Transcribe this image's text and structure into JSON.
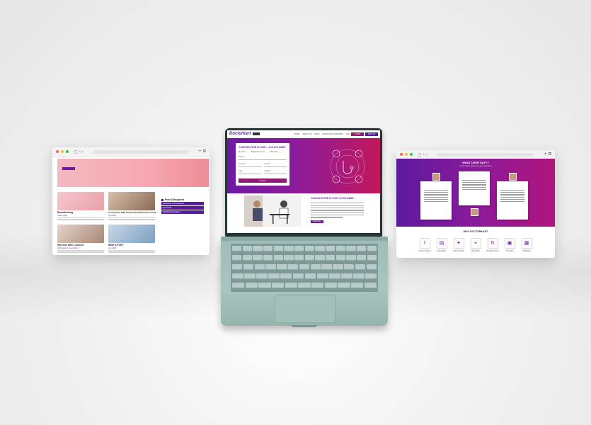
{
  "left_window": {
    "sidebar_title": "Post Categories",
    "categories": [
      "Wellness & Cosmetics",
      "Covid-19",
      "Medical Education"
    ],
    "cards": [
      {
        "title": "Breastfeeding",
        "category": "Child Care"
      },
      {
        "title": "Coronavirus: SMS TO 80 At Risk Will Expect Covid...",
        "category": "Covid19"
      },
      {
        "title": "Hair loss After Covid-19",
        "category": "Wellness & Cosmetics"
      },
      {
        "title": "What is PCR?",
        "category": "Covid19"
      }
    ]
  },
  "right_window": {
    "title": "WHAT USER SAY??",
    "subtitle": "Lorem ipsum dolor sit amet consectetur",
    "why_title": "WHY DOCTORKART",
    "features": [
      "Doctor Connect",
      "Prescription",
      "Online Consult",
      "Find Clinic",
      "Health Records",
      "Lab Tests",
      "Medicines"
    ]
  },
  "laptop": {
    "logo": "Doctorkart",
    "menu": [
      "HOME",
      "ABOUT US",
      "BLOG",
      "DIAGNOSTIC CENTRES",
      "FAQ"
    ],
    "login_label": "LOGIN",
    "signup_label": "SIGN UP",
    "form_title": "YOUR DOCTOR IS JUST... A CLICK AWAY",
    "radio_options": [
      "Doctor",
      "Diagnostic Centre",
      "Pharmacy"
    ],
    "field_labels": [
      "Search",
      "Speciality",
      "Location",
      "Date",
      "Available"
    ],
    "search_button": "Search",
    "section_title": "YOUR DOCTOR IS JUST CLICK AWAY",
    "read_more": "Read More"
  },
  "colors": {
    "primary": "#5a1a9e",
    "accent": "#c2185b"
  }
}
